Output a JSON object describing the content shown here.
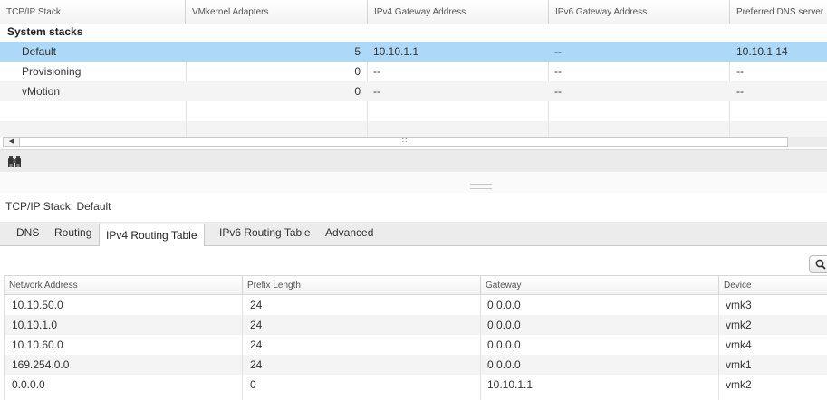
{
  "stack_grid": {
    "columns": [
      "TCP/IP Stack",
      "VMkernel Adapters",
      "IPv4 Gateway Address",
      "IPv6 Gateway Address",
      "Preferred DNS server"
    ],
    "group_label": "System stacks",
    "rows": [
      {
        "name": "Default",
        "adapters": "5",
        "ipv4_gateway": "10.10.1.1",
        "ipv6_gateway": "--",
        "dns": "10.10.1.14",
        "selected": true
      },
      {
        "name": "Provisioning",
        "adapters": "0",
        "ipv4_gateway": "--",
        "ipv6_gateway": "--",
        "dns": "--",
        "selected": false
      },
      {
        "name": "vMotion",
        "adapters": "0",
        "ipv4_gateway": "--",
        "ipv6_gateway": "--",
        "dns": "--",
        "selected": false
      }
    ]
  },
  "toolbar": {
    "find_icon": "binoculars-icon"
  },
  "detail": {
    "title": "TCP/IP Stack: Default",
    "tabs": [
      "DNS",
      "Routing",
      "IPv4 Routing Table",
      "IPv6 Routing Table",
      "Advanced"
    ],
    "active_tab": "IPv4 Routing Table",
    "search_icon": "search-icon"
  },
  "route_table": {
    "columns": [
      "Network Address",
      "Prefix Length",
      "Gateway",
      "Device"
    ],
    "rows": [
      {
        "network": "10.10.50.0",
        "prefix": "24",
        "gateway": "0.0.0.0",
        "device": "vmk3"
      },
      {
        "network": "10.10.1.0",
        "prefix": "24",
        "gateway": "0.0.0.0",
        "device": "vmk2"
      },
      {
        "network": "10.10.60.0",
        "prefix": "24",
        "gateway": "0.0.0.0",
        "device": "vmk4"
      },
      {
        "network": "169.254.0.0",
        "prefix": "24",
        "gateway": "0.0.0.0",
        "device": "vmk1"
      },
      {
        "network": "0.0.0.0",
        "prefix": "0",
        "gateway": "10.10.1.1",
        "device": "vmk2"
      }
    ]
  },
  "colors": {
    "selection": "#add8f7",
    "toolbar": "#ebebeb",
    "tabbar": "#ececec"
  }
}
